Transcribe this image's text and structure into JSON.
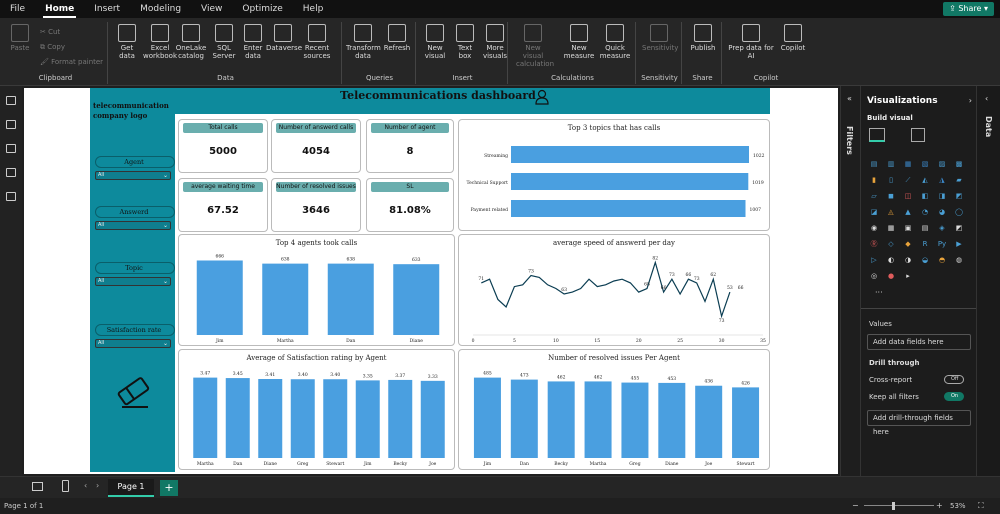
{
  "menu": {
    "items": [
      "File",
      "Home",
      "Insert",
      "Modeling",
      "View",
      "Optimize",
      "Help"
    ],
    "active": "Home",
    "share": "Share"
  },
  "ribbon": {
    "clipboard": {
      "paste": "Paste",
      "cut": "Cut",
      "copy": "Copy",
      "format": "Format painter",
      "label": "Clipboard"
    },
    "data": {
      "buttons": [
        "Get\ndata",
        "Excel\nworkbook",
        "OneLake\ncatalog",
        "SQL\nServer",
        "Enter\ndata",
        "Dataverse",
        "Recent\nsources"
      ],
      "label": "Data"
    },
    "queries": {
      "buttons": [
        "Transform\ndata",
        "Refresh"
      ],
      "label": "Queries"
    },
    "insert": {
      "buttons": [
        "New\nvisual",
        "Text\nbox",
        "More\nvisuals"
      ],
      "label": "Insert"
    },
    "calc": {
      "buttons": [
        "New visual\ncalculation",
        "New\nmeasure",
        "Quick\nmeasure"
      ],
      "label": "Calculations"
    },
    "sens": {
      "buttons": [
        "Sensitivity"
      ],
      "label": "Sensitivity"
    },
    "share": {
      "buttons": [
        "Publish"
      ],
      "label": "Share"
    },
    "copilot": {
      "buttons": [
        "Prep data for\nAI",
        "Copilot"
      ],
      "label": "Copilot"
    }
  },
  "dashboard": {
    "title": "Telecommunications dashboard",
    "logo": "telecommunication\ncompany logo",
    "slicers": [
      {
        "label": "Agent",
        "value": "All"
      },
      {
        "label": "Answerd",
        "value": "All"
      },
      {
        "label": "Topic",
        "value": "All"
      },
      {
        "label": "Satisfaction rate",
        "value": "All"
      }
    ],
    "kpis": [
      {
        "title": "Total calls",
        "value": "5000"
      },
      {
        "title": "Number of answerd calls",
        "value": "4054"
      },
      {
        "title": "Number of agent",
        "value": "8"
      },
      {
        "title": "average waiting time",
        "value": "67.52"
      },
      {
        "title": "Number of resolved issues",
        "value": "3646"
      },
      {
        "title": "SL",
        "value": "81.08%"
      }
    ]
  },
  "chart_data": [
    {
      "type": "bar",
      "orientation": "horizontal",
      "title": "Top 3 topics that has calls",
      "categories": [
        "Streaming",
        "Technical Support",
        "Payment related"
      ],
      "values": [
        1022,
        1019,
        1007
      ]
    },
    {
      "type": "bar",
      "title": "Top 4 agents took calls",
      "categories": [
        "Jim",
        "Martha",
        "Dan",
        "Diane"
      ],
      "values": [
        666,
        638,
        638,
        633
      ]
    },
    {
      "type": "line",
      "title": "average speed of answerd per day",
      "x": [
        1,
        2,
        3,
        4,
        5,
        6,
        7,
        8,
        9,
        10,
        11,
        12,
        13,
        14,
        15,
        16,
        17,
        18,
        19,
        20,
        21,
        22,
        23,
        24,
        25,
        26,
        27,
        28,
        29,
        30,
        31
      ],
      "values": [
        71,
        73,
        62,
        58,
        69,
        70,
        75,
        74,
        70,
        68,
        65,
        66,
        68,
        73,
        69,
        70,
        72,
        73,
        71,
        66,
        68,
        82,
        66,
        73,
        65,
        73,
        71,
        61,
        73,
        53,
        66
      ],
      "labels": {
        "1": "71",
        "7": "73",
        "11": "63",
        "22": "82",
        "21": "68",
        "23": "66",
        "24": "73",
        "26": "66",
        "27": "73",
        "29": "62",
        "30": "73",
        "31": "53",
        "32": "66"
      },
      "xticks": [
        0,
        5,
        10,
        15,
        20,
        25,
        30,
        35
      ],
      "xlim": [
        0,
        35
      ]
    },
    {
      "type": "bar",
      "title": "Average of Satisfaction rating by Agent",
      "categories": [
        "Martha",
        "Dan",
        "Diane",
        "Greg",
        "Stewart",
        "Jim",
        "Becky",
        "Joe"
      ],
      "values": [
        3.47,
        3.45,
        3.41,
        3.4,
        3.4,
        3.35,
        3.37,
        3.33
      ]
    },
    {
      "type": "bar",
      "title": "Number of resolved issues Per Agent",
      "categories": [
        "Jim",
        "Dan",
        "Becky",
        "Martha",
        "Greg",
        "Diane",
        "Joe",
        "Stewart"
      ],
      "values": [
        485,
        473,
        462,
        462,
        455,
        453,
        436,
        426
      ]
    }
  ],
  "filters": {
    "label": "Filters"
  },
  "viz": {
    "title": "Visualizations",
    "build": "Build visual",
    "values": "Values",
    "add_data": "Add data fields here",
    "drill": "Drill through",
    "cross": "Cross-report",
    "cross_state": "Off",
    "keep": "Keep all filters",
    "keep_state": "On",
    "add_drill": "Add drill-through fields here",
    "data_tab": "Data",
    "more": "···"
  },
  "tabs": {
    "page": "Page 1",
    "plus": "+"
  },
  "status": {
    "left": "Page 1 of 1",
    "zoom": "53%"
  }
}
